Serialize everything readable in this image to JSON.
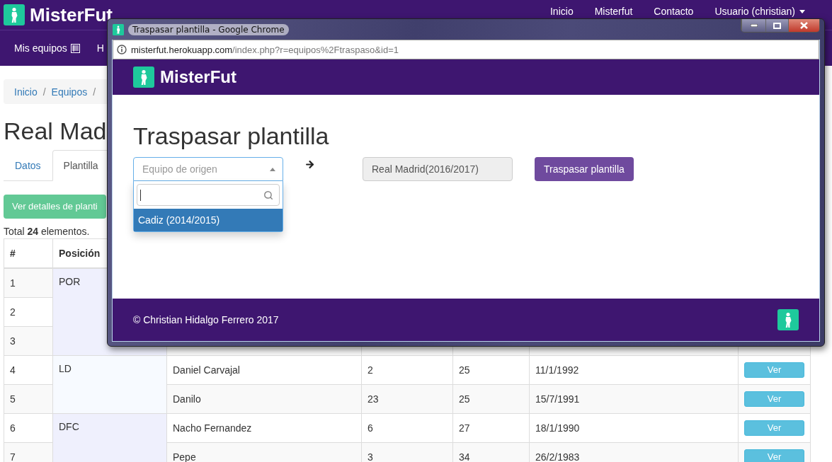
{
  "site": {
    "brand": "MisterFut",
    "nav": [
      {
        "label": "Inicio"
      },
      {
        "label": "Misterfut"
      },
      {
        "label": "Contacto"
      }
    ],
    "user_menu": {
      "label": "Usuario (christian)"
    }
  },
  "subnav": [
    {
      "label": "Mis equipos"
    },
    {
      "label": "H"
    }
  ],
  "breadcrumb": [
    {
      "label": "Inicio",
      "separator": "/"
    },
    {
      "label": "Equipos",
      "separator": "/"
    }
  ],
  "page_title": "Real Mad",
  "tabs": [
    {
      "label": "Datos",
      "selected": false
    },
    {
      "label": "Plantilla",
      "selected": true
    }
  ],
  "details_button": "Ver detalles de planti",
  "total": "Total **24** elementos.",
  "table": {
    "columns": [
      "#",
      "Posición"
    ],
    "groups": [
      {
        "position": "POR",
        "rows": [
          {
            "num": "1"
          },
          {
            "num": "2"
          },
          {
            "num": "3"
          }
        ]
      },
      {
        "position": "LD",
        "rows": [
          {
            "num": "4",
            "name": "Daniel Carvajal",
            "dorsal": "2",
            "age": "25",
            "birth": "11/1/1992",
            "action": "Ver"
          },
          {
            "num": "5",
            "name": "Danilo",
            "dorsal": "23",
            "age": "25",
            "birth": "15/7/1991",
            "action": "Ver"
          }
        ]
      },
      {
        "position": "DFC",
        "rows": [
          {
            "num": "6",
            "name": "Nacho Fernandez",
            "dorsal": "6",
            "age": "27",
            "birth": "18/1/1990",
            "action": "Ver"
          },
          {
            "num": "7",
            "name": "Pepe",
            "dorsal": "3",
            "age": "34",
            "birth": "26/2/1983",
            "action": "Ver"
          }
        ]
      }
    ]
  },
  "popup": {
    "title": "Traspasar plantilla - Google Chrome",
    "url_host": "misterfut.herokuapp.com",
    "url_path": "/index.php?r=equipos%2Ftraspaso&id=1",
    "brand": "MisterFut",
    "heading": "Traspasar plantilla",
    "source_select": {
      "placeholder": "Equipo de origen",
      "expanded": true,
      "options": [
        {
          "label": "Cadiz (2014/2015)",
          "selected": true
        }
      ]
    },
    "target": {
      "value": "Real Madrid(2016/2017)",
      "disabled": true
    },
    "submit": "Traspasar plantilla",
    "footer": "© Christian Hidalgo Ferrero 2017"
  }
}
